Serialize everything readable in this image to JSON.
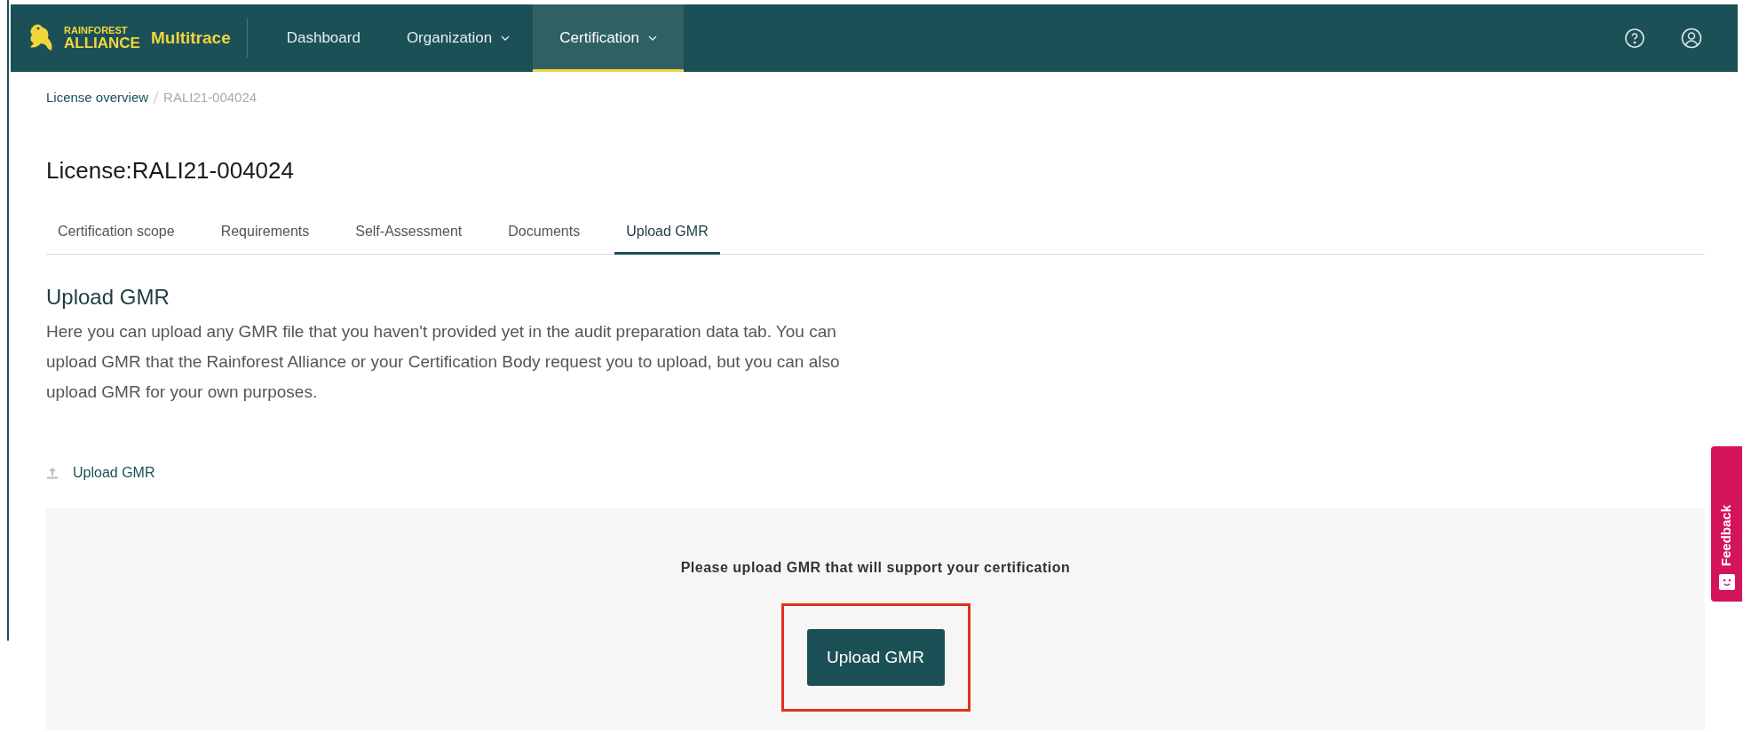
{
  "header": {
    "logo_text": [
      "RAINFOREST",
      "ALLIANCE"
    ],
    "app_name": "Multitrace",
    "nav": [
      {
        "label": "Dashboard",
        "dropdown": false,
        "selected": false
      },
      {
        "label": "Organization",
        "dropdown": true,
        "selected": false
      },
      {
        "label": "Certification",
        "dropdown": true,
        "selected": true
      }
    ]
  },
  "breadcrumb": [
    {
      "label": "License overview",
      "link": true
    },
    {
      "label": "RALI21-004024",
      "link": false
    }
  ],
  "title": "License:RALI21-004024",
  "tabs": [
    {
      "label": "Certification scope",
      "selected": false
    },
    {
      "label": "Requirements",
      "selected": false
    },
    {
      "label": "Self-Assessment",
      "selected": false
    },
    {
      "label": "Documents",
      "selected": false
    },
    {
      "label": "Upload GMR",
      "selected": true
    }
  ],
  "section": {
    "heading": "Upload GMR",
    "description": "Here you can upload any GMR file that you haven't provided yet in the audit preparation data tab. You can upload GMR that the Rainforest Alliance or your Certification Body request you to upload, but you can also upload GMR for your own purposes.",
    "upload_link": "Upload GMR"
  },
  "upload_panel": {
    "prompt": "Please upload GMR that will support your certification",
    "button": "Upload GMR",
    "highlighted": true
  },
  "feedback_tab": "Feedback"
}
